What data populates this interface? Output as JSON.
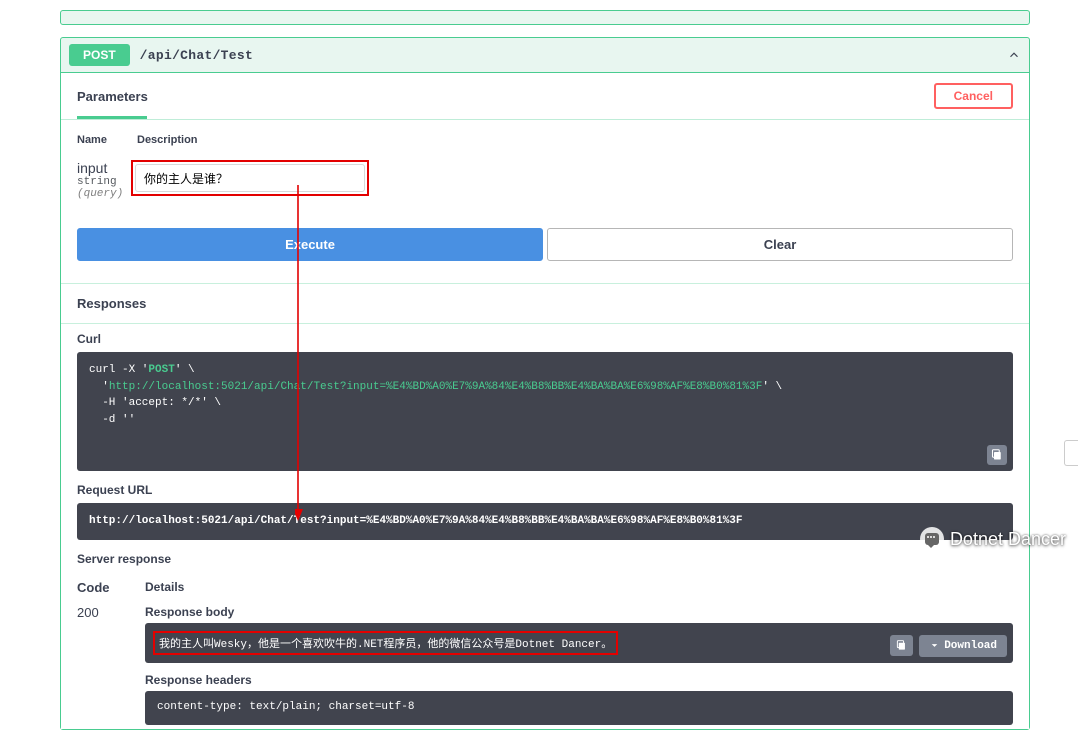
{
  "endpoint": {
    "method": "POST",
    "path": "/api/Chat/Test"
  },
  "parameters": {
    "section_title": "Parameters",
    "cancel_label": "Cancel",
    "columns": {
      "name": "Name",
      "description": "Description"
    },
    "items": [
      {
        "name": "input",
        "type": "string",
        "in": "(query)",
        "value": "你的主人是谁？"
      }
    ]
  },
  "actions": {
    "execute": "Execute",
    "clear": "Clear"
  },
  "responses": {
    "title": "Responses",
    "curl_label": "Curl",
    "curl_text": "curl -X 'POST' \\\n  'http://localhost:5021/api/Chat/Test?input=%E4%BD%A0%E7%9A%84%E4%B8%BB%E4%BA%BA%E6%98%AF%E8%B0%81%3F' \\\n  -H 'accept: */*' \\\n  -d ''",
    "request_url_label": "Request URL",
    "request_url": "http://localhost:5021/api/Chat/Test?input=%E4%BD%A0%E7%9A%84%E4%B8%BB%E4%BA%BA%E6%98%AF%E8%B0%81%3F",
    "server_response_label": "Server response",
    "code_header": "Code",
    "details_header": "Details",
    "items": [
      {
        "code": "200",
        "body_label": "Response body",
        "body": "我的主人叫Wesky，他是一个喜欢吹牛的.NET程序员，他的微信公众号是Dotnet Dancer。",
        "headers_label": "Response headers",
        "headers": " content-type: text/plain; charset=utf-8 "
      }
    ],
    "download_label": "Download"
  },
  "watermark": "Dotnet Dancer"
}
